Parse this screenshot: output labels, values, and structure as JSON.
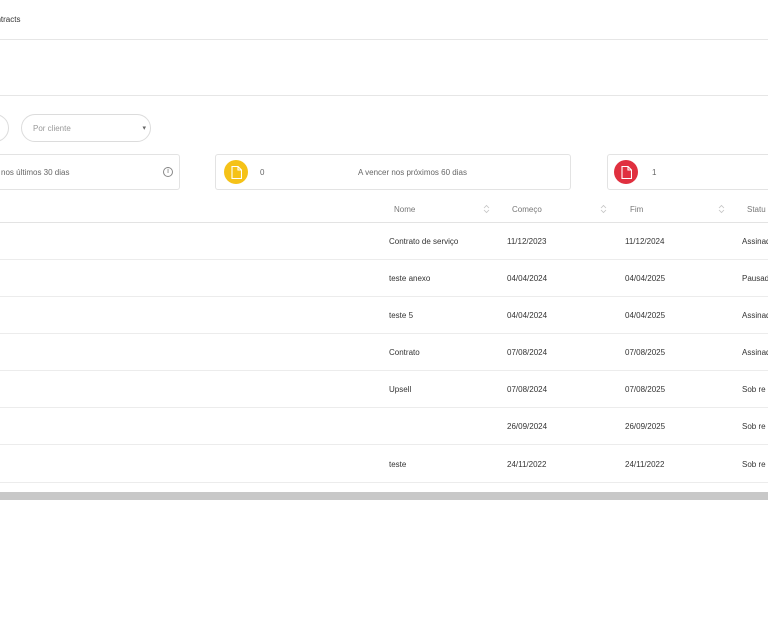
{
  "breadcrumb": {
    "label": "ontracts"
  },
  "filters": {
    "client_placeholder": "Por cliente",
    "caret": "▾"
  },
  "cards": [
    {
      "label": "nos últimos 30 dias",
      "info": "i"
    },
    {
      "count": "0",
      "label": "A vencer nos próximos 60 dias",
      "icon": "document-icon",
      "color": "#f5c218"
    },
    {
      "count": "1",
      "icon": "document-icon",
      "color": "#e0303f"
    }
  ],
  "table": {
    "columns": [
      "Nome",
      "Começo",
      "Fim",
      "Statu"
    ],
    "rows": [
      {
        "left": ":",
        "nome": "Contrato de serviço",
        "comeco": "11/12/2023",
        "fim": "11/12/2024",
        "status": "Assinad"
      },
      {
        "left": "",
        "nome": "teste anexo",
        "comeco": "04/04/2024",
        "fim": "04/04/2025",
        "status": "Pausad"
      },
      {
        "left": "",
        "nome": "teste 5",
        "comeco": "04/04/2024",
        "fim": "04/04/2025",
        "status": "Assinad"
      },
      {
        "left": "",
        "nome": "Contrato",
        "comeco": "07/08/2024",
        "fim": "07/08/2025",
        "status": "Assinad"
      },
      {
        "left": "",
        "nome": "Upsell",
        "comeco": "07/08/2024",
        "fim": "07/08/2025",
        "status": "Sob re"
      },
      {
        "left": "",
        "nome": "",
        "comeco": "26/09/2024",
        "fim": "26/09/2025",
        "status": "Sob re"
      },
      {
        "left": "",
        "nome": "teste",
        "comeco": "24/11/2022",
        "fim": "24/11/2022",
        "status": "Sob re"
      }
    ]
  }
}
